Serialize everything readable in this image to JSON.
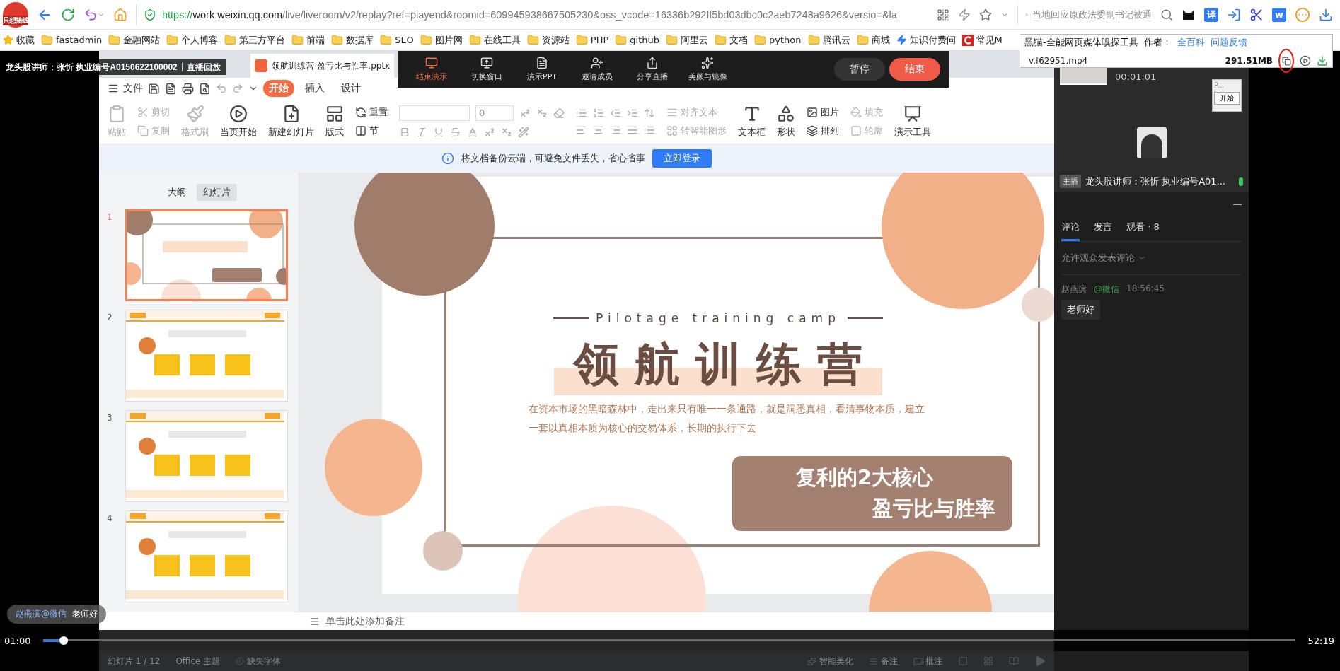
{
  "browser": {
    "logo_text": "只想搞钱",
    "url_scheme": "https://",
    "url_host": "work.weixin.qq.com",
    "url_rest": "/live/liveroom/v2/replay?ref=playend&roomid=609945938667505230&oss_vcode=16336b292ff5bd03dbc0c2aeb7248a9626&versio=&la",
    "search_text": "当地回应原政法委副书记被通",
    "translate_glyph": "译",
    "doc_glyph": "w"
  },
  "bookmarks": [
    {
      "label": "收藏",
      "kind": "star"
    },
    {
      "label": "fastadmin",
      "kind": "folder"
    },
    {
      "label": "金融网站",
      "kind": "folder"
    },
    {
      "label": "个人博客",
      "kind": "folder"
    },
    {
      "label": "第三方平台",
      "kind": "folder"
    },
    {
      "label": "前端",
      "kind": "folder"
    },
    {
      "label": "数据库",
      "kind": "folder"
    },
    {
      "label": "SEO",
      "kind": "folder"
    },
    {
      "label": "图片网",
      "kind": "folder"
    },
    {
      "label": "在线工具",
      "kind": "folder"
    },
    {
      "label": "资源站",
      "kind": "folder"
    },
    {
      "label": "PHP",
      "kind": "folder"
    },
    {
      "label": "github",
      "kind": "folder"
    },
    {
      "label": "阿里云",
      "kind": "folder"
    },
    {
      "label": "文档",
      "kind": "folder"
    },
    {
      "label": "python",
      "kind": "folder"
    },
    {
      "label": "腾讯云",
      "kind": "folder"
    },
    {
      "label": "商城",
      "kind": "folder"
    },
    {
      "label": "知识付费问",
      "kind": "bolt"
    },
    {
      "label": "常见M",
      "kind": "brand"
    }
  ],
  "extension_popup": {
    "title": "黑猫-全能网页媒体嗅探工具",
    "author_label": "作者：",
    "links": [
      "全百科",
      "问题反馈"
    ],
    "file": "v.f62951.mp4",
    "size": "291.51MB"
  },
  "live": {
    "title": "龙头股讲师：张忻 执业编号A0150622100002",
    "mode": "直播回放"
  },
  "doc_tab": "领航训练营-盈亏比与胜率.pptx",
  "presenter_toolbar": {
    "tools": [
      {
        "label": "结束演示",
        "selected": true
      },
      {
        "label": "切换窗口",
        "selected": false
      },
      {
        "label": "演示PPT",
        "selected": false
      },
      {
        "label": "邀请成员",
        "selected": false
      },
      {
        "label": "分享直播",
        "selected": false
      },
      {
        "label": "美颜与镜像",
        "selected": false
      }
    ],
    "pause": "暂停",
    "end": "结束"
  },
  "menu": {
    "file": "文件",
    "tabs": [
      {
        "label": "开始",
        "selected": true
      },
      {
        "label": "插入",
        "selected": false
      },
      {
        "label": "设计",
        "selected": false
      }
    ]
  },
  "ribbon": [
    {
      "kind": "big",
      "label": "粘贴",
      "disabled": true
    },
    {
      "kind": "stack",
      "items": [
        {
          "label": "剪切",
          "disabled": true
        },
        {
          "label": "复制",
          "disabled": true
        }
      ]
    },
    {
      "kind": "big",
      "label": "格式刷",
      "disabled": true
    },
    {
      "kind": "big",
      "label": "当页开始",
      "disabled": false
    },
    {
      "kind": "big",
      "label": "新建幻灯片",
      "disabled": false
    },
    {
      "kind": "big",
      "label": "版式",
      "disabled": false
    },
    {
      "kind": "stack",
      "items": [
        {
          "label": "重置",
          "disabled": false
        },
        {
          "label": "节",
          "disabled": false
        }
      ]
    },
    {
      "kind": "font",
      "size": "0"
    },
    {
      "kind": "paragraph"
    },
    {
      "kind": "stack",
      "items": [
        {
          "label": "对齐文本",
          "disabled": true
        },
        {
          "label": "转智能图形",
          "disabled": true
        }
      ]
    },
    {
      "kind": "big",
      "label": "文本框",
      "disabled": false
    },
    {
      "kind": "big",
      "label": "形状",
      "disabled": false
    },
    {
      "kind": "stack",
      "items": [
        {
          "label": "图片",
          "disabled": false
        },
        {
          "label": "排列",
          "disabled": false
        }
      ]
    },
    {
      "kind": "stack",
      "items": [
        {
          "label": "填充",
          "disabled": true
        },
        {
          "label": "轮廓",
          "disabled": true
        }
      ]
    },
    {
      "kind": "big",
      "label": "演示工具",
      "disabled": false
    }
  ],
  "notice": {
    "text": "将文档备份云端，可避免文件丢失，省心省事",
    "button": "立即登录"
  },
  "slide_panel": {
    "tabs": [
      {
        "label": "大纲",
        "selected": false
      },
      {
        "label": "幻灯片",
        "selected": true
      }
    ],
    "slides": [
      {
        "number": "1",
        "kind": "cover",
        "selected": true
      },
      {
        "number": "2",
        "kind": "content",
        "selected": false
      },
      {
        "number": "3",
        "kind": "content",
        "selected": false
      },
      {
        "number": "4",
        "kind": "content",
        "selected": false
      }
    ]
  },
  "slide": {
    "subtitle": "Pilotage training camp",
    "title": "领航训练营",
    "body_lines": [
      "在资本市场的黑暗森林中，走出来只有唯一一条通路，就是洞悉真相，看清事物本质，建立",
      "一套以真相本质为核心的交易体系，长期的执行下去"
    ],
    "callout": [
      "复利的2大核心",
      "盈亏比与胜率"
    ]
  },
  "notes_placeholder": "单击此处添加备注",
  "status": {
    "slide_count": "幻灯片 1 / 12",
    "theme": "Office 主题",
    "missing_font": "缺失字体",
    "beautify": "智能美化",
    "notes": "备注",
    "comments": "批注"
  },
  "danmaku": {
    "user": "赵燕滨@微信",
    "text": "老师好"
  },
  "player": {
    "elapsed": "01:00",
    "duration": "52:19",
    "level": 0.016
  },
  "right_panel": {
    "preview_time": "00:01:01",
    "mini_window": {
      "title": "P...",
      "button": "开始"
    },
    "host_badge": "主播",
    "host_name": "龙头股讲师：张忻 执业编号A01...",
    "tabs": [
      {
        "label": "评论",
        "selected": true
      },
      {
        "label": "发言",
        "selected": false
      },
      {
        "label": "观看 · 8",
        "selected": false
      }
    ],
    "permission": "允许观众发表评论",
    "comments": [
      {
        "user": "赵燕滨",
        "source": "@微信",
        "time": "18:56:45",
        "text": "老师好"
      }
    ]
  }
}
